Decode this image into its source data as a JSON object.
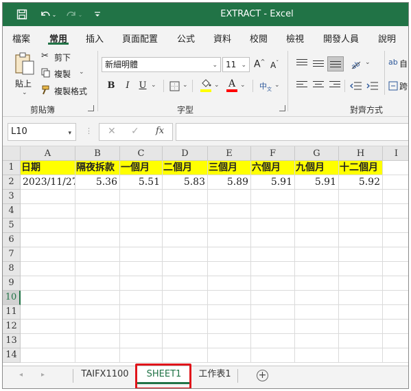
{
  "window": {
    "title": "EXTRACT  -  Excel",
    "quick_access": [
      "save-icon",
      "undo-icon",
      "redo-icon",
      "customize-icon"
    ]
  },
  "ribbon_tabs": [
    {
      "label": "檔案",
      "active": false
    },
    {
      "label": "常用",
      "active": true
    },
    {
      "label": "插入",
      "active": false
    },
    {
      "label": "頁面配置",
      "active": false
    },
    {
      "label": "公式",
      "active": false
    },
    {
      "label": "資料",
      "active": false
    },
    {
      "label": "校閱",
      "active": false
    },
    {
      "label": "檢視",
      "active": false
    },
    {
      "label": "開發人員",
      "active": false
    },
    {
      "label": "說明",
      "active": false
    }
  ],
  "clipboard": {
    "paste": "貼上",
    "cut": "剪下",
    "copy": "複製",
    "format_painter": "複製格式",
    "group_label": "剪貼簿"
  },
  "font": {
    "name": "新細明體",
    "size": "11",
    "bold": "B",
    "italic": "I",
    "underline": "U",
    "group_label": "字型",
    "highlight_color": "#ffff00",
    "font_color": "#ff0000",
    "phonetic": "中"
  },
  "alignment": {
    "group_label": "對齊方式",
    "wrap_partial": "自",
    "merge_partial": "跨"
  },
  "formula_bar": {
    "name_box": "L10",
    "formula": ""
  },
  "sheet": {
    "columns": [
      "A",
      "B",
      "C",
      "D",
      "E",
      "F",
      "G",
      "H",
      "I"
    ],
    "rows": [
      "1",
      "2",
      "3",
      "4",
      "5",
      "6",
      "7",
      "8",
      "9",
      "10",
      "11",
      "12",
      "13",
      "14"
    ],
    "selected_row": "10",
    "header_row": [
      "日期",
      "隔夜拆款",
      "一個月",
      "二個月",
      "三個月",
      "六個月",
      "九個月",
      "十二個月"
    ],
    "data_row": [
      "2023/11/27",
      "5.36",
      "5.51",
      "5.83",
      "5.89",
      "5.91",
      "5.91",
      "5.92"
    ]
  },
  "sheet_tabs": [
    {
      "label": "TAIFX1100",
      "active": false
    },
    {
      "label": "SHEET1",
      "active": true
    },
    {
      "label": "工作表1",
      "active": false
    }
  ],
  "colors": {
    "accent": "#217346",
    "header_fill": "#ffff00",
    "highlight_box": "#e0141a"
  }
}
